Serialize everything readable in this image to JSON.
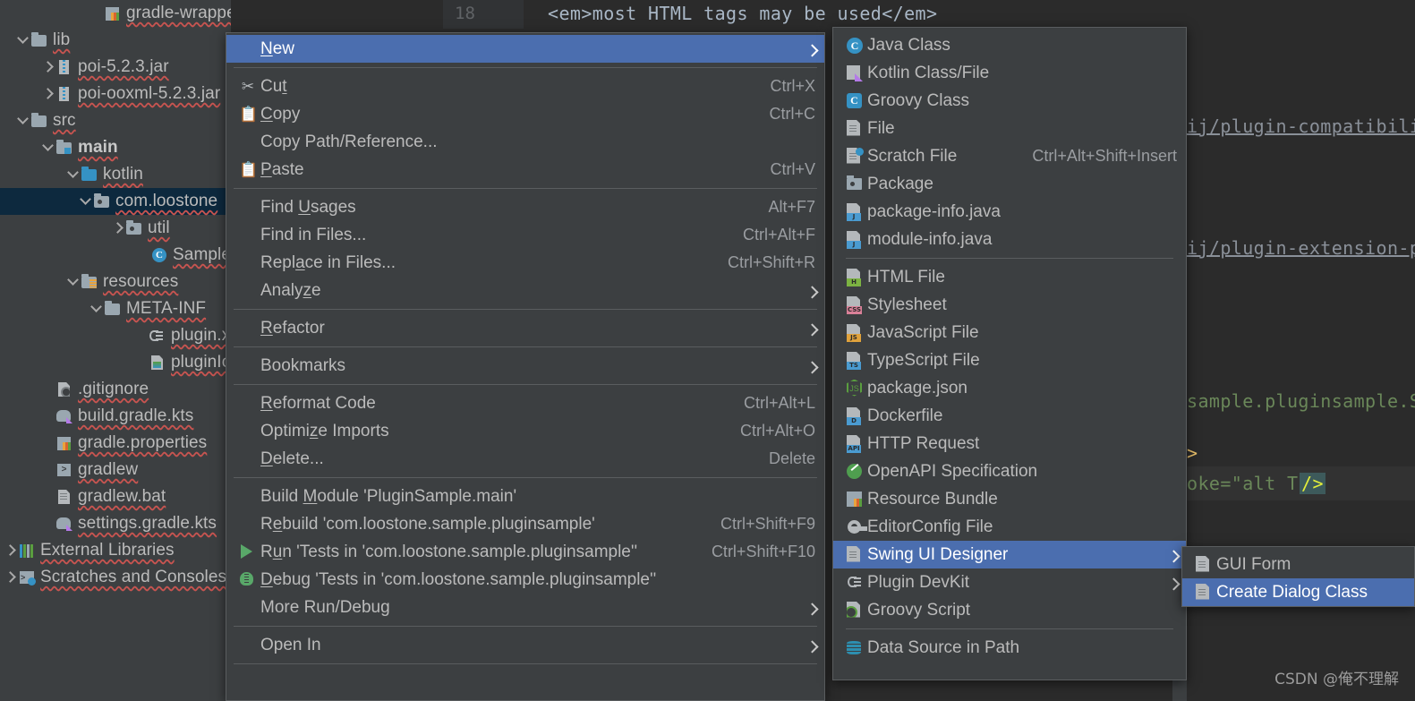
{
  "editor": {
    "line_number": "18",
    "top_code": "<em>most HTML tags may be used</em>",
    "fragments": [
      "ij/plugin-compatibili",
      "ij/plugin-extension-p",
      "sample.pluginsample.S",
      ">",
      "oke=\"alt T\"",
      "/>"
    ]
  },
  "sidebar": {
    "items": [
      {
        "label": "gradle-wrapper.properties",
        "indent": 100,
        "toggle": "none",
        "icon": "chart-file-icon",
        "selected": false,
        "bold": false
      },
      {
        "label": "lib",
        "indent": 18,
        "toggle": "down",
        "icon": "folder-icon",
        "selected": false,
        "bold": false
      },
      {
        "label": "poi-5.2.3.jar",
        "indent": 46,
        "toggle": "right",
        "icon": "jar-icon",
        "selected": false,
        "bold": false
      },
      {
        "label": "poi-ooxml-5.2.3.jar",
        "indent": 46,
        "toggle": "right",
        "icon": "jar-icon",
        "selected": false,
        "bold": false
      },
      {
        "label": "src",
        "indent": 18,
        "toggle": "down",
        "icon": "folder-icon",
        "selected": false,
        "bold": false
      },
      {
        "label": "main",
        "indent": 46,
        "toggle": "down",
        "icon": "source-folder-icon",
        "selected": false,
        "bold": true
      },
      {
        "label": "kotlin",
        "indent": 74,
        "toggle": "down",
        "icon": "folder-blue-icon",
        "selected": false,
        "bold": false
      },
      {
        "label": "com.loostone",
        "indent": 88,
        "toggle": "down",
        "icon": "package-icon",
        "selected": true,
        "bold": false
      },
      {
        "label": "util",
        "indent": 124,
        "toggle": "right",
        "icon": "package-icon",
        "selected": false,
        "bold": false
      },
      {
        "label": "SampleA",
        "indent": 152,
        "toggle": "none",
        "icon": "kotlin-class-icon",
        "selected": false,
        "bold": false
      },
      {
        "label": "resources",
        "indent": 74,
        "toggle": "down",
        "icon": "resources-folder-icon",
        "selected": false,
        "bold": false
      },
      {
        "label": "META-INF",
        "indent": 100,
        "toggle": "down",
        "icon": "folder-icon",
        "selected": false,
        "bold": false
      },
      {
        "label": "plugin.xml",
        "indent": 150,
        "toggle": "none",
        "icon": "plugin-icon",
        "selected": false,
        "bold": false
      },
      {
        "label": "pluginIcon",
        "indent": 150,
        "toggle": "none",
        "icon": "image-file-icon",
        "selected": false,
        "bold": false
      },
      {
        "label": ".gitignore",
        "indent": 46,
        "toggle": "none",
        "icon": "gitignore-icon",
        "selected": false,
        "bold": false
      },
      {
        "label": "build.gradle.kts",
        "indent": 46,
        "toggle": "none",
        "icon": "gradle-icon",
        "selected": false,
        "bold": false
      },
      {
        "label": "gradle.properties",
        "indent": 46,
        "toggle": "none",
        "icon": "chart-file-icon",
        "selected": false,
        "bold": false
      },
      {
        "label": "gradlew",
        "indent": 46,
        "toggle": "none",
        "icon": "terminal-icon",
        "selected": false,
        "bold": false
      },
      {
        "label": "gradlew.bat",
        "indent": 46,
        "toggle": "none",
        "icon": "file-icon",
        "selected": false,
        "bold": false
      },
      {
        "label": "settings.gradle.kts",
        "indent": 46,
        "toggle": "none",
        "icon": "gradle-icon",
        "selected": false,
        "bold": false
      },
      {
        "label": "External Libraries",
        "indent": 4,
        "toggle": "right",
        "icon": "libraries-icon",
        "selected": false,
        "bold": false
      },
      {
        "label": "Scratches and Consoles",
        "indent": 4,
        "toggle": "right",
        "icon": "scratches-icon",
        "selected": false,
        "bold": false
      }
    ]
  },
  "context_menu": {
    "items": [
      {
        "type": "item",
        "label": "New",
        "mnemonic": "N",
        "accel": "",
        "icon": "",
        "arrow": true,
        "highlight": true
      },
      {
        "type": "sep"
      },
      {
        "type": "item",
        "label": "Cut",
        "mnemonic": "t",
        "accel": "Ctrl+X",
        "icon": "cut-icon",
        "arrow": false,
        "highlight": false
      },
      {
        "type": "item",
        "label": "Copy",
        "mnemonic": "C",
        "accel": "Ctrl+C",
        "icon": "copy-icon",
        "arrow": false,
        "highlight": false
      },
      {
        "type": "item",
        "label": "Copy Path/Reference...",
        "mnemonic": "",
        "accel": "",
        "icon": "",
        "arrow": false,
        "highlight": false
      },
      {
        "type": "item",
        "label": "Paste",
        "mnemonic": "P",
        "accel": "Ctrl+V",
        "icon": "paste-icon",
        "arrow": false,
        "highlight": false
      },
      {
        "type": "sep"
      },
      {
        "type": "item",
        "label": "Find Usages",
        "mnemonic": "U",
        "accel": "Alt+F7",
        "icon": "",
        "arrow": false,
        "highlight": false
      },
      {
        "type": "item",
        "label": "Find in Files...",
        "mnemonic": "",
        "accel": "Ctrl+Alt+F",
        "icon": "",
        "arrow": false,
        "highlight": false
      },
      {
        "type": "item",
        "label": "Replace in Files...",
        "mnemonic": "a",
        "accel": "Ctrl+Shift+R",
        "icon": "",
        "arrow": false,
        "highlight": false
      },
      {
        "type": "item",
        "label": "Analyze",
        "mnemonic": "z",
        "accel": "",
        "icon": "",
        "arrow": true,
        "highlight": false
      },
      {
        "type": "sep"
      },
      {
        "type": "item",
        "label": "Refactor",
        "mnemonic": "R",
        "accel": "",
        "icon": "",
        "arrow": true,
        "highlight": false
      },
      {
        "type": "sep"
      },
      {
        "type": "item",
        "label": "Bookmarks",
        "mnemonic": "",
        "accel": "",
        "icon": "",
        "arrow": true,
        "highlight": false
      },
      {
        "type": "sep"
      },
      {
        "type": "item",
        "label": "Reformat Code",
        "mnemonic": "R",
        "accel": "Ctrl+Alt+L",
        "icon": "",
        "arrow": false,
        "highlight": false
      },
      {
        "type": "item",
        "label": "Optimize Imports",
        "mnemonic": "z",
        "accel": "Ctrl+Alt+O",
        "icon": "",
        "arrow": false,
        "highlight": false
      },
      {
        "type": "item",
        "label": "Delete...",
        "mnemonic": "D",
        "accel": "Delete",
        "icon": "",
        "arrow": false,
        "highlight": false
      },
      {
        "type": "sep"
      },
      {
        "type": "item",
        "label": "Build Module 'PluginSample.main'",
        "mnemonic": "M",
        "accel": "",
        "icon": "",
        "arrow": false,
        "highlight": false
      },
      {
        "type": "item",
        "label": "Rebuild 'com.loostone.sample.pluginsample'",
        "mnemonic": "e",
        "accel": "Ctrl+Shift+F9",
        "icon": "",
        "arrow": false,
        "highlight": false
      },
      {
        "type": "item",
        "label": "Run 'Tests in 'com.loostone.sample.pluginsample''",
        "mnemonic": "u",
        "accel": "Ctrl+Shift+F10",
        "icon": "run-icon",
        "arrow": false,
        "highlight": false
      },
      {
        "type": "item",
        "label": "Debug 'Tests in 'com.loostone.sample.pluginsample''",
        "mnemonic": "D",
        "accel": "",
        "icon": "debug-icon",
        "arrow": false,
        "highlight": false
      },
      {
        "type": "item",
        "label": "More Run/Debug",
        "mnemonic": "",
        "accel": "",
        "icon": "",
        "arrow": true,
        "highlight": false
      },
      {
        "type": "sep"
      },
      {
        "type": "item",
        "label": "Open In",
        "mnemonic": "",
        "accel": "",
        "icon": "",
        "arrow": true,
        "highlight": false
      },
      {
        "type": "sep"
      }
    ]
  },
  "new_submenu": {
    "items": [
      {
        "type": "item",
        "label": "Java Class",
        "accel": "",
        "icon": "java-class-icon",
        "arrow": false,
        "highlight": false
      },
      {
        "type": "item",
        "label": "Kotlin Class/File",
        "accel": "",
        "icon": "kotlin-file-icon",
        "arrow": false,
        "highlight": false
      },
      {
        "type": "item",
        "label": "Groovy Class",
        "accel": "",
        "icon": "groovy-class-icon",
        "arrow": false,
        "highlight": false
      },
      {
        "type": "item",
        "label": "File",
        "accel": "",
        "icon": "file-icon",
        "arrow": false,
        "highlight": false
      },
      {
        "type": "item",
        "label": "Scratch File",
        "accel": "Ctrl+Alt+Shift+Insert",
        "icon": "scratch-file-icon",
        "arrow": false,
        "highlight": false
      },
      {
        "type": "item",
        "label": "Package",
        "accel": "",
        "icon": "package-icon",
        "arrow": false,
        "highlight": false
      },
      {
        "type": "item",
        "label": "package-info.java",
        "accel": "",
        "icon": "java-file-icon",
        "arrow": false,
        "highlight": false
      },
      {
        "type": "item",
        "label": "module-info.java",
        "accel": "",
        "icon": "java-file-icon",
        "arrow": false,
        "highlight": false
      },
      {
        "type": "sep"
      },
      {
        "type": "item",
        "label": "HTML File",
        "accel": "",
        "icon": "html-file-icon",
        "arrow": false,
        "highlight": false
      },
      {
        "type": "item",
        "label": "Stylesheet",
        "accel": "",
        "icon": "css-file-icon",
        "arrow": false,
        "highlight": false
      },
      {
        "type": "item",
        "label": "JavaScript File",
        "accel": "",
        "icon": "js-file-icon",
        "arrow": false,
        "highlight": false
      },
      {
        "type": "item",
        "label": "TypeScript File",
        "accel": "",
        "icon": "ts-file-icon",
        "arrow": false,
        "highlight": false
      },
      {
        "type": "item",
        "label": "package.json",
        "accel": "",
        "icon": "nodejs-icon",
        "arrow": false,
        "highlight": false
      },
      {
        "type": "item",
        "label": "Dockerfile",
        "accel": "",
        "icon": "docker-file-icon",
        "arrow": false,
        "highlight": false
      },
      {
        "type": "item",
        "label": "HTTP Request",
        "accel": "",
        "icon": "http-file-icon",
        "arrow": false,
        "highlight": false
      },
      {
        "type": "item",
        "label": "OpenAPI Specification",
        "accel": "",
        "icon": "openapi-icon",
        "arrow": false,
        "highlight": false
      },
      {
        "type": "item",
        "label": "Resource Bundle",
        "accel": "",
        "icon": "resource-bundle-icon",
        "arrow": false,
        "highlight": false
      },
      {
        "type": "item",
        "label": "EditorConfig File",
        "accel": "",
        "icon": "gear-icon",
        "arrow": false,
        "highlight": false
      },
      {
        "type": "item",
        "label": "Swing UI Designer",
        "accel": "",
        "icon": "file-icon",
        "arrow": true,
        "highlight": true
      },
      {
        "type": "item",
        "label": "Plugin DevKit",
        "accel": "",
        "icon": "plugin-icon",
        "arrow": true,
        "highlight": false
      },
      {
        "type": "item",
        "label": "Groovy Script",
        "accel": "",
        "icon": "groovy-script-icon",
        "arrow": false,
        "highlight": false
      },
      {
        "type": "sep"
      },
      {
        "type": "item",
        "label": "Data Source in Path",
        "accel": "",
        "icon": "database-icon",
        "arrow": false,
        "highlight": false
      }
    ]
  },
  "swing_submenu": {
    "items": [
      {
        "label": "GUI Form",
        "icon": "file-icon",
        "highlight": false
      },
      {
        "label": "Create Dialog Class",
        "icon": "file-icon",
        "highlight": true
      }
    ]
  },
  "watermark": {
    "text": "CSDN @俺不理解"
  },
  "colors": {
    "menu_bg": "#3c3f41",
    "highlight": "#4b6eaf",
    "tree_selection": "#0d293e",
    "editor_bg": "#2b2b2b",
    "text": "#bbbbbb"
  }
}
